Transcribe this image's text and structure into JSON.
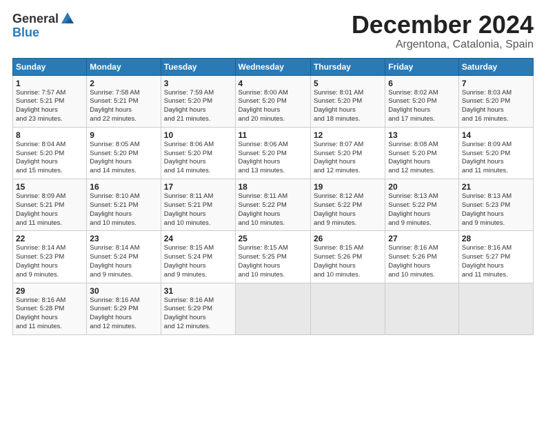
{
  "logo": {
    "general": "General",
    "blue": "Blue"
  },
  "title": "December 2024",
  "subtitle": "Argentona, Catalonia, Spain",
  "days_header": [
    "Sunday",
    "Monday",
    "Tuesday",
    "Wednesday",
    "Thursday",
    "Friday",
    "Saturday"
  ],
  "weeks": [
    [
      {
        "day": "1",
        "sunrise": "7:57 AM",
        "sunset": "5:21 PM",
        "daylight": "9 hours and 23 minutes."
      },
      {
        "day": "2",
        "sunrise": "7:58 AM",
        "sunset": "5:21 PM",
        "daylight": "9 hours and 22 minutes."
      },
      {
        "day": "3",
        "sunrise": "7:59 AM",
        "sunset": "5:20 PM",
        "daylight": "9 hours and 21 minutes."
      },
      {
        "day": "4",
        "sunrise": "8:00 AM",
        "sunset": "5:20 PM",
        "daylight": "9 hours and 20 minutes."
      },
      {
        "day": "5",
        "sunrise": "8:01 AM",
        "sunset": "5:20 PM",
        "daylight": "9 hours and 18 minutes."
      },
      {
        "day": "6",
        "sunrise": "8:02 AM",
        "sunset": "5:20 PM",
        "daylight": "9 hours and 17 minutes."
      },
      {
        "day": "7",
        "sunrise": "8:03 AM",
        "sunset": "5:20 PM",
        "daylight": "9 hours and 16 minutes."
      }
    ],
    [
      {
        "day": "8",
        "sunrise": "8:04 AM",
        "sunset": "5:20 PM",
        "daylight": "9 hours and 15 minutes."
      },
      {
        "day": "9",
        "sunrise": "8:05 AM",
        "sunset": "5:20 PM",
        "daylight": "9 hours and 14 minutes."
      },
      {
        "day": "10",
        "sunrise": "8:06 AM",
        "sunset": "5:20 PM",
        "daylight": "9 hours and 14 minutes."
      },
      {
        "day": "11",
        "sunrise": "8:06 AM",
        "sunset": "5:20 PM",
        "daylight": "9 hours and 13 minutes."
      },
      {
        "day": "12",
        "sunrise": "8:07 AM",
        "sunset": "5:20 PM",
        "daylight": "9 hours and 12 minutes."
      },
      {
        "day": "13",
        "sunrise": "8:08 AM",
        "sunset": "5:20 PM",
        "daylight": "9 hours and 12 minutes."
      },
      {
        "day": "14",
        "sunrise": "8:09 AM",
        "sunset": "5:20 PM",
        "daylight": "9 hours and 11 minutes."
      }
    ],
    [
      {
        "day": "15",
        "sunrise": "8:09 AM",
        "sunset": "5:21 PM",
        "daylight": "9 hours and 11 minutes."
      },
      {
        "day": "16",
        "sunrise": "8:10 AM",
        "sunset": "5:21 PM",
        "daylight": "9 hours and 10 minutes."
      },
      {
        "day": "17",
        "sunrise": "8:11 AM",
        "sunset": "5:21 PM",
        "daylight": "9 hours and 10 minutes."
      },
      {
        "day": "18",
        "sunrise": "8:11 AM",
        "sunset": "5:22 PM",
        "daylight": "9 hours and 10 minutes."
      },
      {
        "day": "19",
        "sunrise": "8:12 AM",
        "sunset": "5:22 PM",
        "daylight": "9 hours and 9 minutes."
      },
      {
        "day": "20",
        "sunrise": "8:13 AM",
        "sunset": "5:22 PM",
        "daylight": "9 hours and 9 minutes."
      },
      {
        "day": "21",
        "sunrise": "8:13 AM",
        "sunset": "5:23 PM",
        "daylight": "9 hours and 9 minutes."
      }
    ],
    [
      {
        "day": "22",
        "sunrise": "8:14 AM",
        "sunset": "5:23 PM",
        "daylight": "9 hours and 9 minutes."
      },
      {
        "day": "23",
        "sunrise": "8:14 AM",
        "sunset": "5:24 PM",
        "daylight": "9 hours and 9 minutes."
      },
      {
        "day": "24",
        "sunrise": "8:15 AM",
        "sunset": "5:24 PM",
        "daylight": "9 hours and 9 minutes."
      },
      {
        "day": "25",
        "sunrise": "8:15 AM",
        "sunset": "5:25 PM",
        "daylight": "9 hours and 10 minutes."
      },
      {
        "day": "26",
        "sunrise": "8:15 AM",
        "sunset": "5:26 PM",
        "daylight": "9 hours and 10 minutes."
      },
      {
        "day": "27",
        "sunrise": "8:16 AM",
        "sunset": "5:26 PM",
        "daylight": "9 hours and 10 minutes."
      },
      {
        "day": "28",
        "sunrise": "8:16 AM",
        "sunset": "5:27 PM",
        "daylight": "9 hours and 11 minutes."
      }
    ],
    [
      {
        "day": "29",
        "sunrise": "8:16 AM",
        "sunset": "5:28 PM",
        "daylight": "9 hours and 11 minutes."
      },
      {
        "day": "30",
        "sunrise": "8:16 AM",
        "sunset": "5:29 PM",
        "daylight": "9 hours and 12 minutes."
      },
      {
        "day": "31",
        "sunrise": "8:16 AM",
        "sunset": "5:29 PM",
        "daylight": "9 hours and 12 minutes."
      },
      null,
      null,
      null,
      null
    ]
  ]
}
